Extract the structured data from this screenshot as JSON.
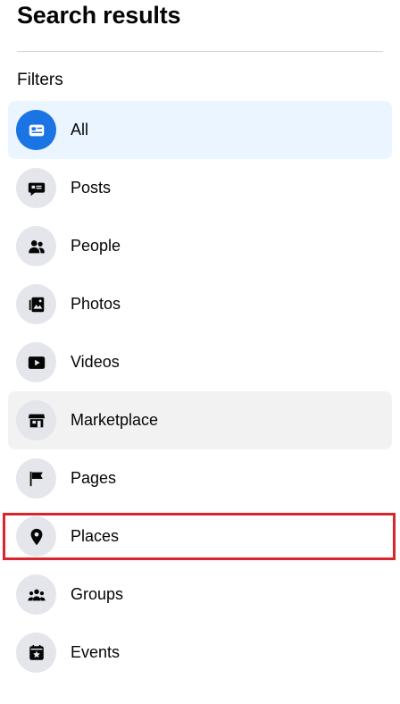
{
  "header": {
    "title": "Search results"
  },
  "filters": {
    "heading": "Filters",
    "items": [
      {
        "label": "All",
        "icon": "feed-icon",
        "state": "selected"
      },
      {
        "label": "Posts",
        "icon": "post-icon"
      },
      {
        "label": "People",
        "icon": "people-icon"
      },
      {
        "label": "Photos",
        "icon": "photos-icon"
      },
      {
        "label": "Videos",
        "icon": "video-icon"
      },
      {
        "label": "Marketplace",
        "icon": "store-icon",
        "state": "hover"
      },
      {
        "label": "Pages",
        "icon": "flag-icon"
      },
      {
        "label": "Places",
        "icon": "location-pin-icon",
        "state": "highlighted"
      },
      {
        "label": "Groups",
        "icon": "groups-icon"
      },
      {
        "label": "Events",
        "icon": "calendar-star-icon"
      }
    ]
  },
  "colors": {
    "accent": "#1b74e4",
    "selected_bg": "#ebf5ff",
    "hover_bg": "#f2f2f2",
    "icon_bg": "#e4e6eb",
    "highlight_border": "#d9252c"
  }
}
